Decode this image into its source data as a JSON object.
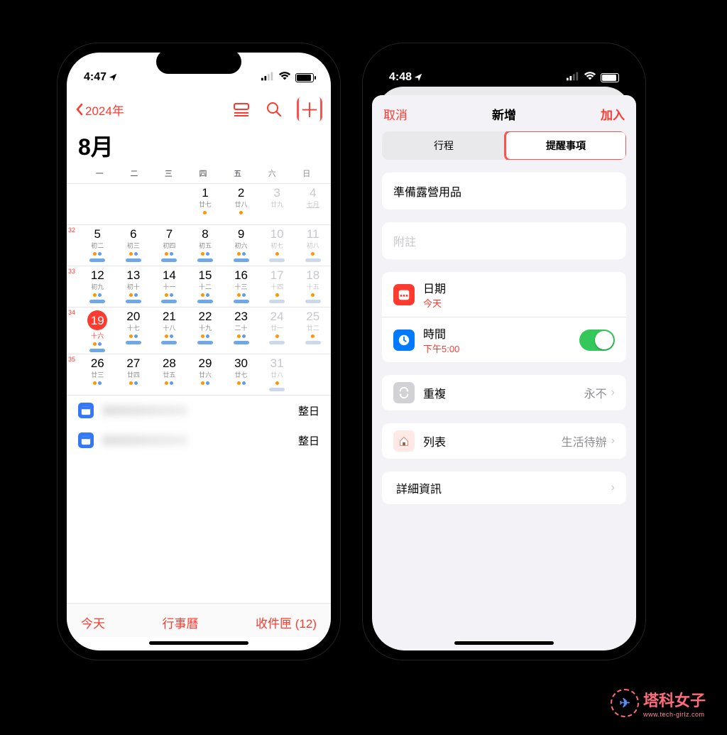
{
  "phone1": {
    "status": {
      "time": "4:47",
      "loc_icon": "location-nav-icon"
    },
    "back_year": "2024年",
    "month": "8月",
    "weekdays": [
      "一",
      "二",
      "三",
      "四",
      "五",
      "六",
      "日"
    ],
    "week_numbers": [
      "",
      "32",
      "33",
      "34",
      "35"
    ],
    "grid": [
      [
        {
          "d": "",
          "l": ""
        },
        {
          "d": "",
          "l": ""
        },
        {
          "d": "",
          "l": ""
        },
        {
          "d": "1",
          "l": "廿七"
        },
        {
          "d": "2",
          "l": "廿八"
        },
        {
          "d": "3",
          "l": "廿九",
          "other": true
        },
        {
          "d": "4",
          "l": "七月",
          "other": true,
          "u": true
        }
      ],
      [
        {
          "d": "5",
          "l": "初二"
        },
        {
          "d": "6",
          "l": "初三"
        },
        {
          "d": "7",
          "l": "初四"
        },
        {
          "d": "8",
          "l": "初五"
        },
        {
          "d": "9",
          "l": "初六"
        },
        {
          "d": "10",
          "l": "初七",
          "other": true
        },
        {
          "d": "11",
          "l": "初八",
          "other": true
        }
      ],
      [
        {
          "d": "12",
          "l": "初九"
        },
        {
          "d": "13",
          "l": "初十"
        },
        {
          "d": "14",
          "l": "十一"
        },
        {
          "d": "15",
          "l": "十二"
        },
        {
          "d": "16",
          "l": "十三"
        },
        {
          "d": "17",
          "l": "十四",
          "other": true
        },
        {
          "d": "18",
          "l": "十五",
          "other": true
        }
      ],
      [
        {
          "d": "19",
          "l": "十六",
          "sel": true
        },
        {
          "d": "20",
          "l": "十七"
        },
        {
          "d": "21",
          "l": "十八"
        },
        {
          "d": "22",
          "l": "十九"
        },
        {
          "d": "23",
          "l": "二十"
        },
        {
          "d": "24",
          "l": "廿一",
          "other": true
        },
        {
          "d": "25",
          "l": "廿二",
          "other": true
        }
      ],
      [
        {
          "d": "26",
          "l": "廿三"
        },
        {
          "d": "27",
          "l": "廿四"
        },
        {
          "d": "28",
          "l": "廿五"
        },
        {
          "d": "29",
          "l": "廿六"
        },
        {
          "d": "30",
          "l": "廿七"
        },
        {
          "d": "31",
          "l": "廿八",
          "other": true
        },
        {
          "d": "",
          "l": ""
        }
      ]
    ],
    "events": [
      {
        "title_redacted": true,
        "allday": "整日"
      },
      {
        "title_redacted": true,
        "allday": "整日"
      }
    ],
    "footer": {
      "today": "今天",
      "calendars": "行事曆",
      "inbox": "收件匣 (12)"
    }
  },
  "phone2": {
    "status": {
      "time": "4:48"
    },
    "sheet_header": {
      "cancel": "取消",
      "title": "新增",
      "add": "加入"
    },
    "segments": {
      "left": "行程",
      "right": "提醒事項"
    },
    "reminder_title": "準備露營用品",
    "notes_placeholder": "附註",
    "rows": {
      "date": {
        "label": "日期",
        "sub": "今天"
      },
      "time": {
        "label": "時間",
        "sub": "下午5:00"
      },
      "repeat": {
        "label": "重複",
        "value": "永不"
      },
      "list": {
        "label": "列表",
        "value": "生活待辦"
      },
      "details": {
        "label": "詳細資訊"
      }
    }
  },
  "watermark": {
    "text": "塔科女子",
    "sub": "www.tech-girlz.com"
  }
}
